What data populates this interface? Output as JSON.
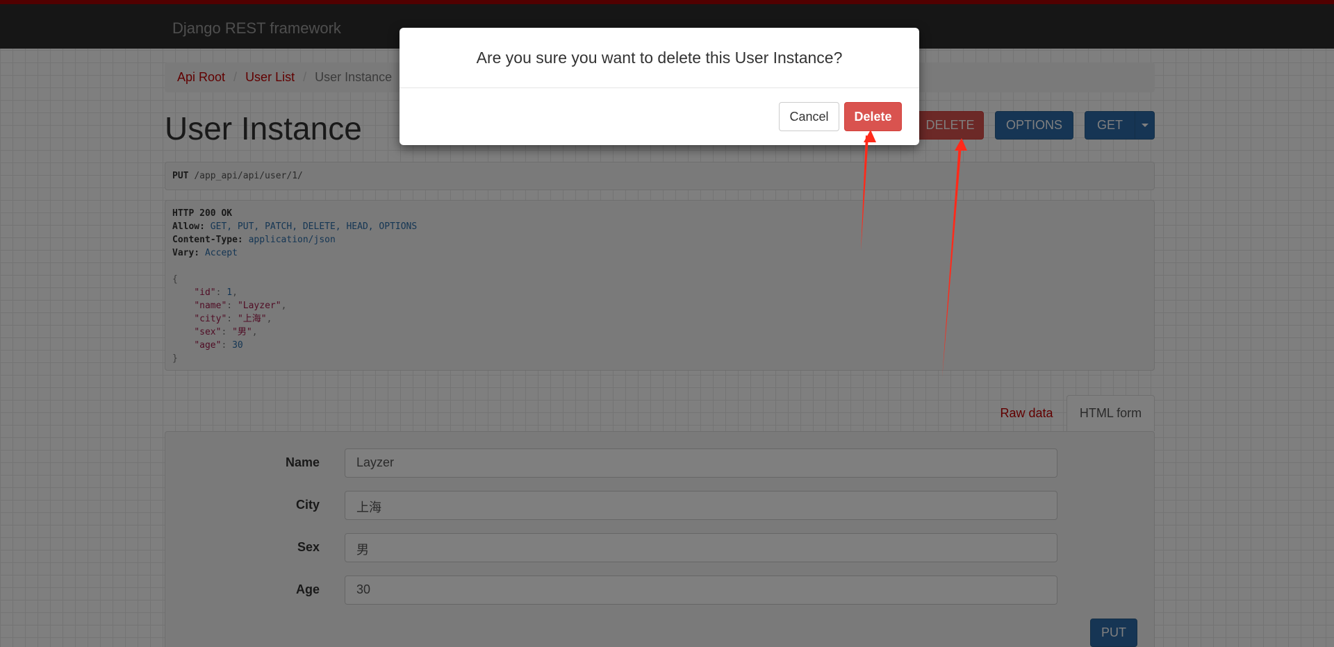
{
  "navbar": {
    "brand": "Django REST framework"
  },
  "breadcrumb": {
    "items": [
      "Api Root",
      "User List",
      "User Instance"
    ],
    "separator": "/"
  },
  "page": {
    "title": "User Instance"
  },
  "toolbar": {
    "delete_label": "DELETE",
    "options_label": "OPTIONS",
    "get_label": "GET"
  },
  "request": {
    "method": "PUT",
    "path": "/app_api/api/user/1/"
  },
  "response": {
    "status": "HTTP 200 OK",
    "headers": [
      {
        "name": "Allow:",
        "value": "GET, PUT, PATCH, DELETE, HEAD, OPTIONS"
      },
      {
        "name": "Content-Type:",
        "value": "application/json"
      },
      {
        "name": "Vary:",
        "value": "Accept"
      }
    ],
    "body": {
      "open": "{",
      "close": "}",
      "fields": [
        {
          "key": "\"id\"",
          "value": "1",
          "type": "number"
        },
        {
          "key": "\"name\"",
          "value": "\"Layzer\"",
          "type": "string"
        },
        {
          "key": "\"city\"",
          "value": "\"上海\"",
          "type": "string"
        },
        {
          "key": "\"sex\"",
          "value": "\"男\"",
          "type": "string"
        },
        {
          "key": "\"age\"",
          "value": "30",
          "type": "number"
        }
      ]
    }
  },
  "tabs": {
    "raw_data": "Raw data",
    "html_form": "HTML form"
  },
  "form": {
    "fields": [
      {
        "label": "Name",
        "value": "Layzer"
      },
      {
        "label": "City",
        "value": "上海"
      },
      {
        "label": "Sex",
        "value": "男"
      },
      {
        "label": "Age",
        "value": "30"
      }
    ],
    "submit_label": "PUT"
  },
  "modal": {
    "title": "Are you sure you want to delete this User Instance?",
    "cancel_label": "Cancel",
    "delete_label": "Delete"
  },
  "colors": {
    "danger": "#d9534f",
    "primary": "#2c6aa8",
    "link": "#c20000",
    "navbar": "#2c2c2c",
    "annotation_arrow": "#ff2a1a"
  }
}
